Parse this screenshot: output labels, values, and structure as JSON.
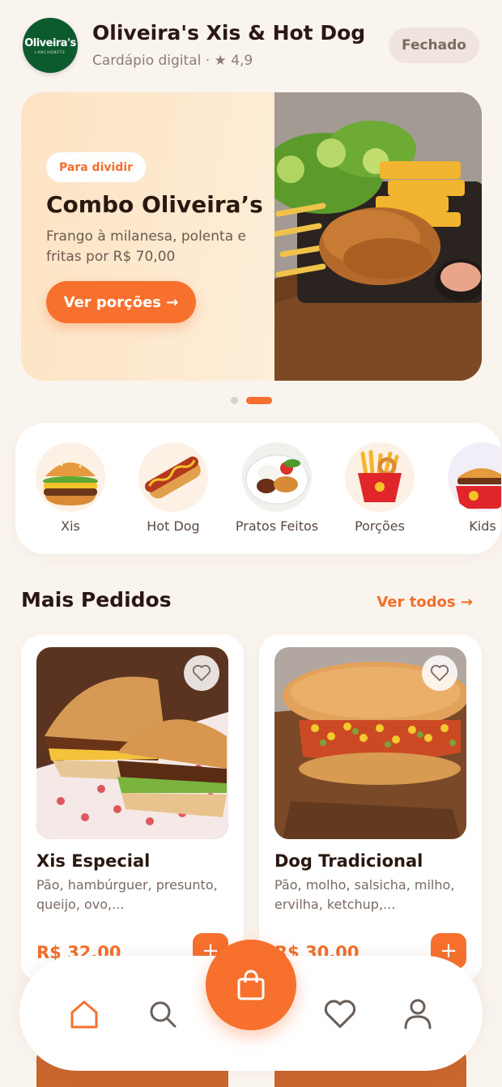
{
  "header": {
    "logo_text": "Oliveira's",
    "logo_subtext": "LANCHONETE",
    "store_name": "Oliveira's Xis & Hot Dog",
    "subtitle": "Cardápio digital · ★ 4,9",
    "status": "Fechado"
  },
  "banner": {
    "tag": "Para dividir",
    "title": "Combo Oliveira’s",
    "description": "Frango à milanesa, polenta e fritas por R$ 70,00",
    "button_label": "Ver porções →",
    "active_slide": 2,
    "slide_count": 2
  },
  "categories": [
    {
      "label": "Xis",
      "icon": "burger-icon"
    },
    {
      "label": "Hot Dog",
      "icon": "hotdog-icon"
    },
    {
      "label": "Pratos Feitos",
      "icon": "plate-icon"
    },
    {
      "label": "Porções",
      "icon": "fries-icon"
    },
    {
      "label": "Kids",
      "icon": "kids-meal-icon"
    }
  ],
  "section": {
    "title": "Mais Pedidos",
    "see_all": "Ver todos →"
  },
  "products": [
    {
      "name": "Xis Especial",
      "description": "Pão, hambúrguer, presunto, queijo, ovo,...",
      "price": "R$ 32,00"
    },
    {
      "name": "Dog Tradicional",
      "description": "Pão, molho, salsicha, milho, ervilha, ketchup,...",
      "price": "R$ 30,00"
    }
  ],
  "nav": {
    "items": [
      "home-icon",
      "search-icon",
      "cart-icon",
      "heart-icon",
      "user-icon"
    ],
    "active": "home-icon"
  },
  "colors": {
    "accent": "#f7702d",
    "background": "#faf4ef",
    "logo_green": "#0e5a2f"
  }
}
